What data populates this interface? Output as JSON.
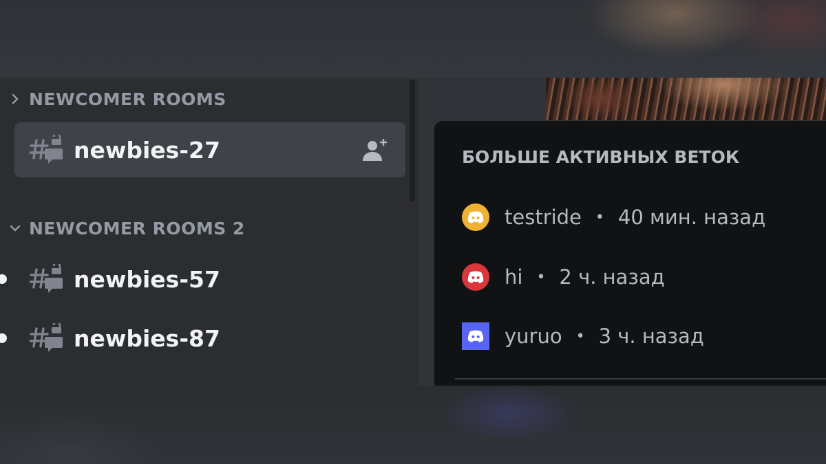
{
  "sidebar": {
    "categories": [
      {
        "label": "NEWCOMER ROOMS",
        "collapsed": true
      },
      {
        "label": "NEWCOMER ROOMS 2",
        "collapsed": false
      }
    ],
    "channels": [
      {
        "name": "newbies-27",
        "selected": true,
        "unread": false,
        "icon": "locked-thread-channel-icon"
      },
      {
        "name": "newbies-57",
        "selected": false,
        "unread": true,
        "icon": "locked-thread-channel-icon"
      },
      {
        "name": "newbies-87",
        "selected": false,
        "unread": true,
        "icon": "locked-thread-channel-icon"
      }
    ]
  },
  "popup": {
    "title": "БОЛЬШЕ АКТИВНЫХ ВЕТОК",
    "threads": [
      {
        "name": "testride",
        "separator": "•",
        "time": "40 мин. назад",
        "avatar_color": "#f0b232"
      },
      {
        "name": "hi",
        "separator": "•",
        "time": "2 ч. назад",
        "avatar_color": "#da373c"
      },
      {
        "name": "yuruo",
        "separator": "•",
        "time": "3 ч. назад",
        "avatar_color": "#5865f2"
      }
    ]
  },
  "colors": {
    "sidebar_bg": "#2b2d31",
    "selected_bg": "#404249",
    "popup_bg": "#111214",
    "muted_text": "#949ba4",
    "bright_text": "#f2f3f5"
  }
}
